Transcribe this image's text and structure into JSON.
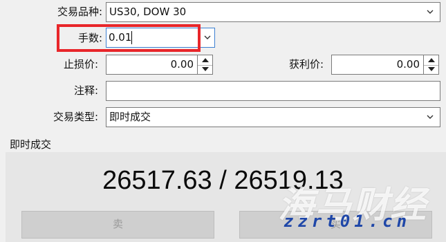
{
  "form": {
    "symbol_label": "交易品种:",
    "symbol_value": "US30, DOW 30",
    "volume_label": "手数:",
    "volume_value": "0.01",
    "sl_label": "止损价:",
    "sl_value": "0.00",
    "tp_label": "获利价:",
    "tp_value": "0.00",
    "comment_label": "注释:",
    "comment_value": "",
    "type_label": "交易类型:",
    "type_value": "即时成交"
  },
  "execution": {
    "group_title": "即时成交",
    "prices": "26517.63 / 26519.13",
    "sell_label": "卖",
    "buy_label": "买"
  },
  "watermark": {
    "text_big": "海马财经",
    "text_small": "zzrt01.cn"
  },
  "colors": {
    "highlight": "#e8262a",
    "watermark_blue": "#1f47a8"
  }
}
